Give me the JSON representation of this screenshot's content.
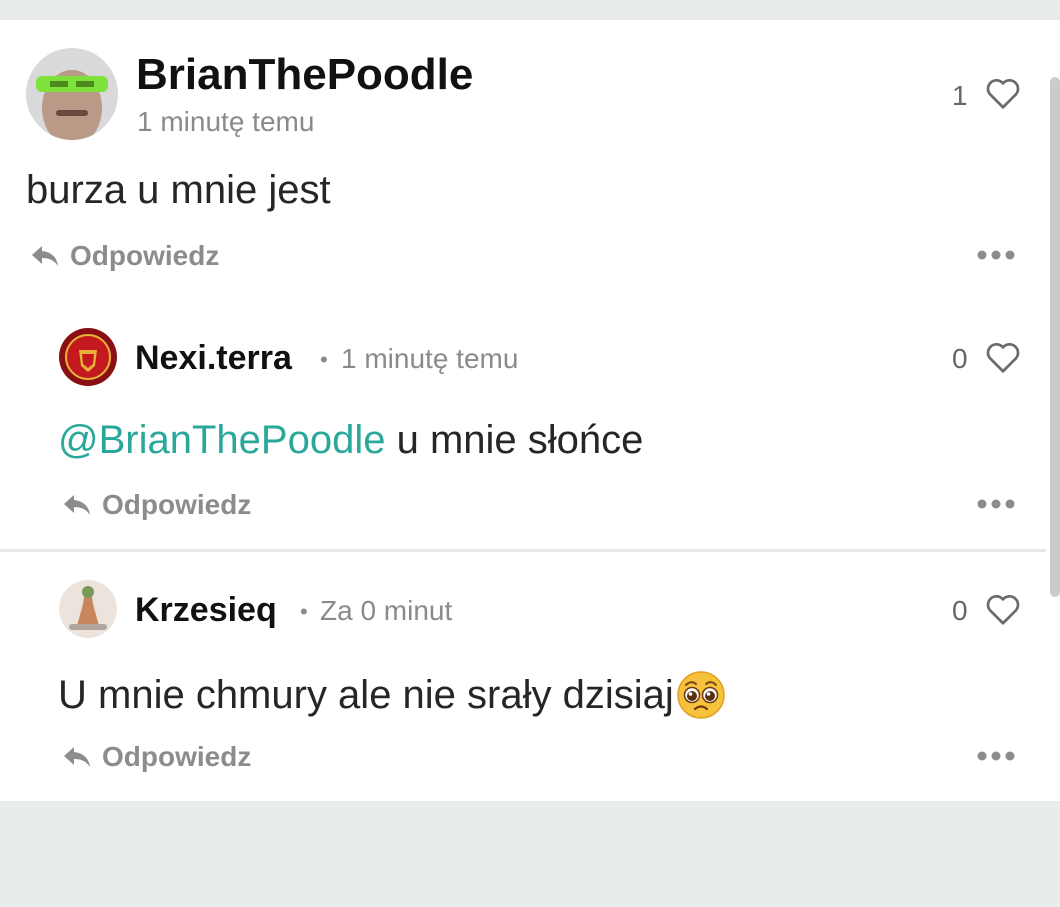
{
  "comments": [
    {
      "author": "BrianThePoodle",
      "time": "1 minutę temu",
      "text": "burza u mnie jest",
      "likes": "1",
      "reply_label": "Odpowiedz",
      "replies": [
        {
          "author": "Nexi.terra",
          "separator": "•",
          "time": "1 minutę temu",
          "mention": "@BrianThePoodle",
          "text": " u mnie słońce",
          "likes": "0",
          "reply_label": "Odpowiedz"
        }
      ]
    },
    {
      "author": "Krzesieq",
      "separator": "•",
      "time": "Za 0 minut",
      "text": "U mnie chmury ale nie srały dzisiaj",
      "emoji": "🥺",
      "likes": "0",
      "reply_label": "Odpowiedz"
    }
  ],
  "icons": {
    "like": "heart-outline-icon",
    "reply": "reply-arrow-icon",
    "more": "more-horizontal-icon"
  },
  "colors": {
    "mention": "#2aa89a",
    "background": "#e9ecec",
    "card": "#ffffff"
  }
}
